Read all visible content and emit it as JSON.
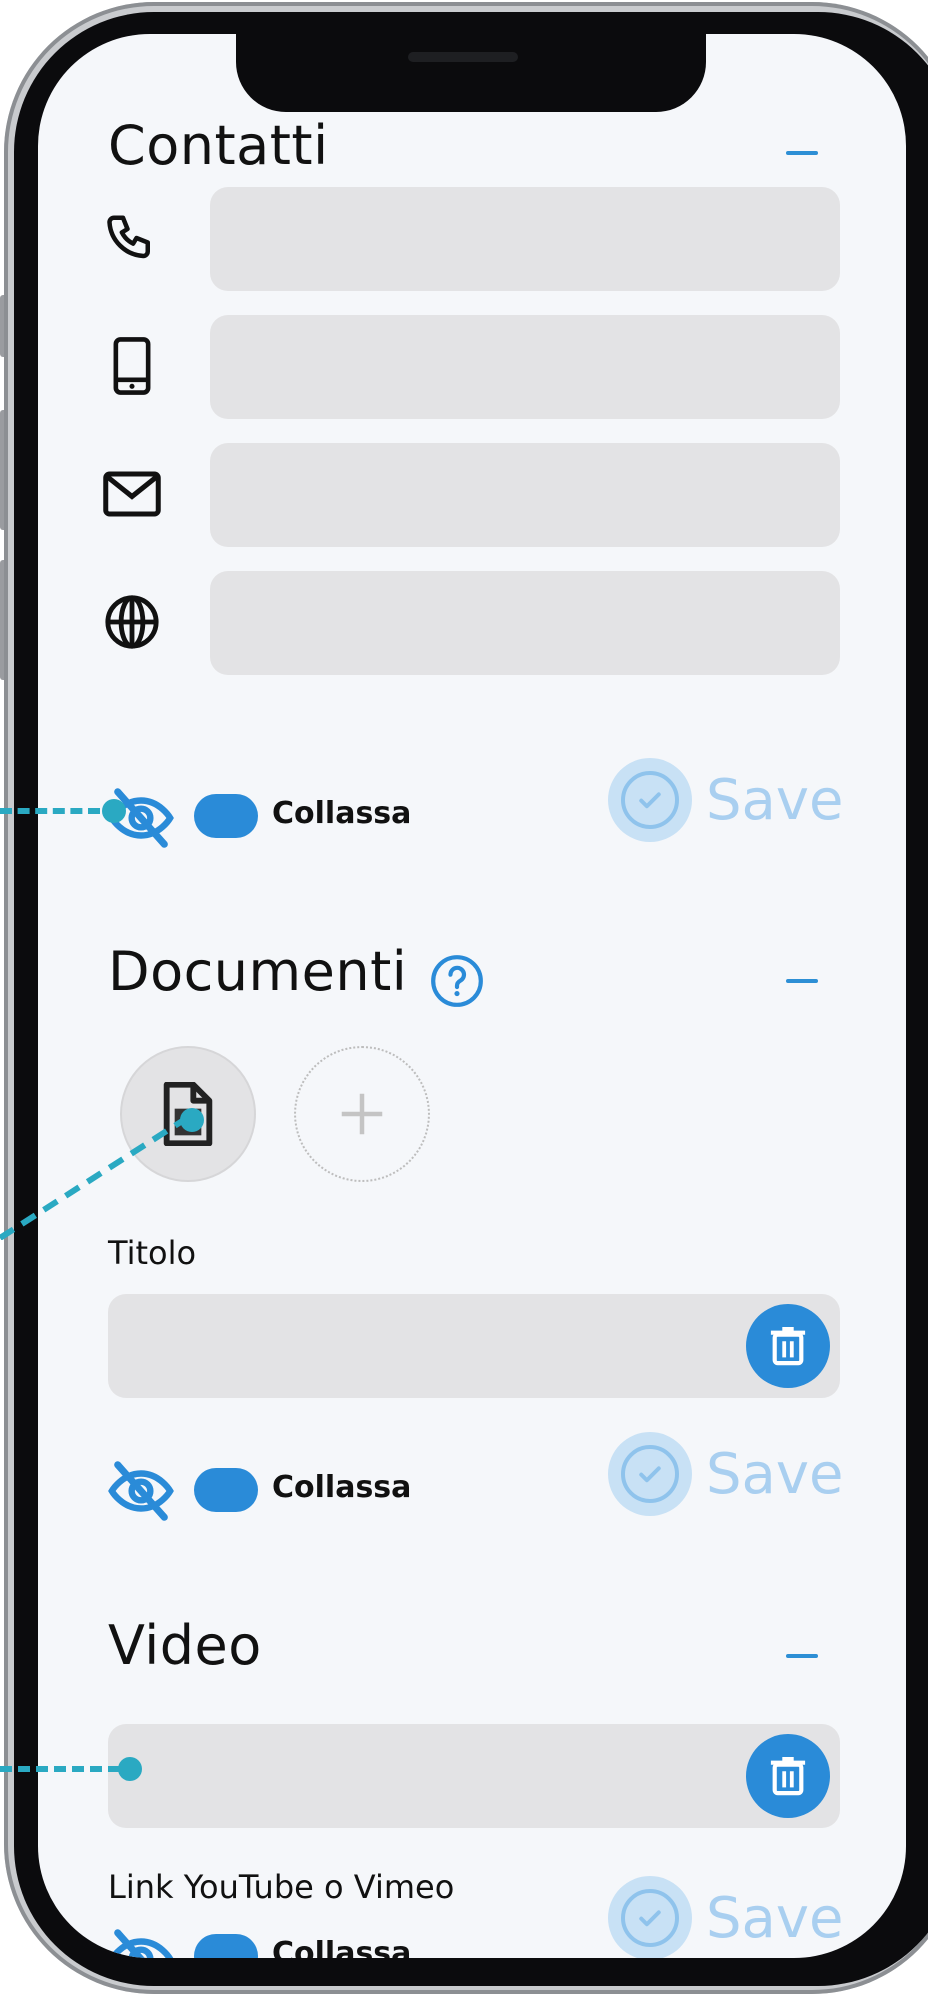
{
  "contacts": {
    "title": "Contatti",
    "fields": [
      {
        "icon": "phone-icon",
        "value": ""
      },
      {
        "icon": "mobile-icon",
        "value": ""
      },
      {
        "icon": "mail-icon",
        "value": ""
      },
      {
        "icon": "globe-icon",
        "value": ""
      }
    ],
    "collapse_label": "Collassa",
    "save_label": "Save"
  },
  "documents": {
    "title": "Documenti",
    "title_label": "Titolo",
    "title_value": "",
    "collapse_label": "Collassa",
    "save_label": "Save"
  },
  "video": {
    "title": "Video",
    "link_value": "",
    "link_label": "Link YouTube o Vimeo",
    "collapse_label": "Collassa",
    "save_label": "Save"
  },
  "colors": {
    "accent": "#2a8bd8",
    "annotation": "#2aa9c2",
    "field": "#e3e3e5",
    "save_disabled": "#a9cff0"
  }
}
